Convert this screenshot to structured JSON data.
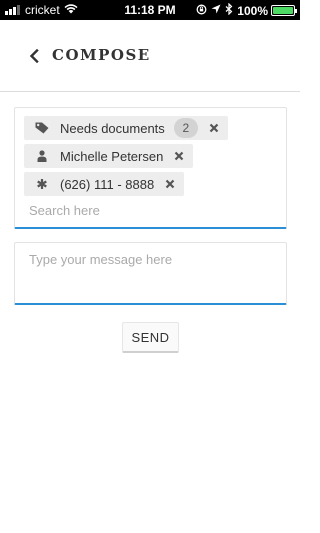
{
  "status_bar": {
    "carrier": "cricket",
    "time": "11:18 PM",
    "battery_percent": "100%",
    "battery_level": 1.0,
    "icons": [
      "signal-icon",
      "wifi-icon",
      "rotation-lock-icon",
      "location-arrow-icon",
      "bluetooth-icon",
      "battery-icon"
    ]
  },
  "header": {
    "title": "COMPOSE",
    "back_icon": "chevron-left-icon"
  },
  "recipients": {
    "chips": [
      {
        "label": "Needs documents",
        "count": "2",
        "icon": "tag-icon"
      },
      {
        "label": "Michelle Petersen",
        "icon": "person-icon"
      },
      {
        "label": "(626) 111 - 8888",
        "icon": "asterisk-icon"
      }
    ],
    "search": {
      "placeholder": "Search here",
      "value": ""
    }
  },
  "message": {
    "placeholder": "Type your message here",
    "value": ""
  },
  "send": {
    "label": "SEND"
  },
  "colors": {
    "accent": "#2a8fd4",
    "chip_bg": "#ededed",
    "battery": "#4cd964"
  }
}
